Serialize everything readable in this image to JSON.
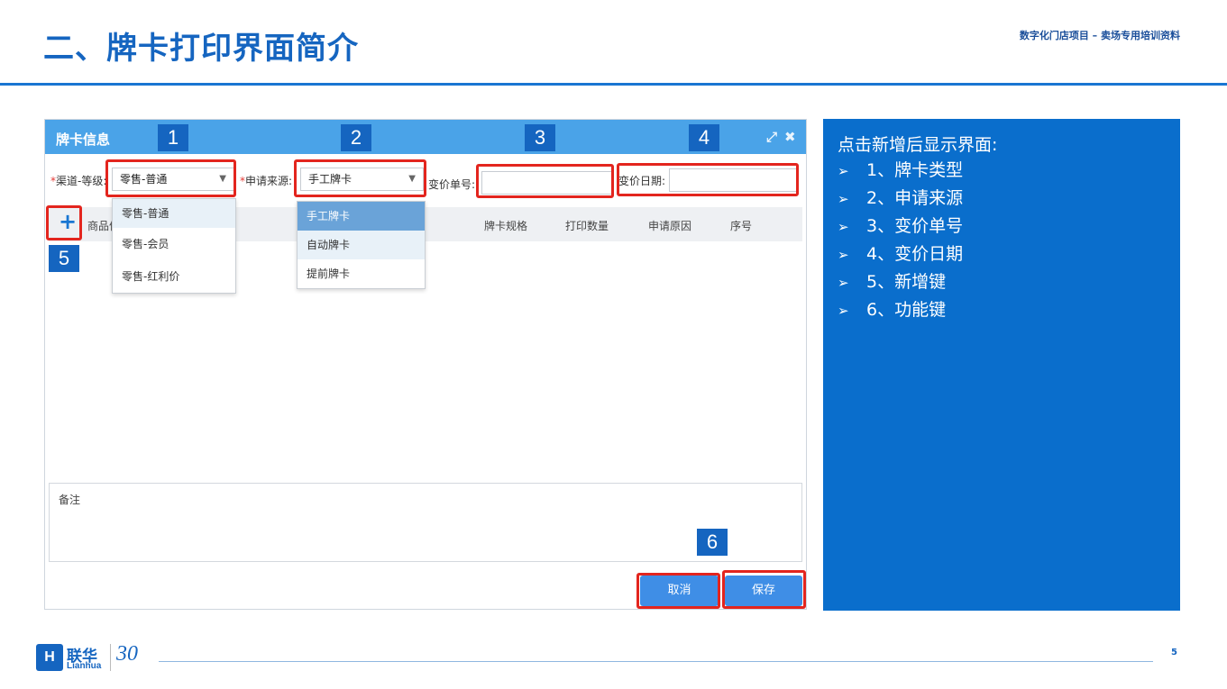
{
  "slide": {
    "title": "二、牌卡打印界面简介",
    "header_note": "数字化门店项目 – 卖场专用培训资料",
    "page_number": "5"
  },
  "dialog": {
    "title": "牌卡信息",
    "expand_icon": "expand-icon",
    "close_icon": "close-icon",
    "channel": {
      "label": "渠道-等级:",
      "required_mark": "*",
      "value": "零售-普通",
      "options": [
        "零售-普通",
        "零售-会员",
        "零售-红利价"
      ]
    },
    "source": {
      "label": "申请来源:",
      "required_mark": "*",
      "value": "手工牌卡",
      "options": [
        "手工牌卡",
        "自动牌卡",
        "提前牌卡"
      ]
    },
    "price_change_no": {
      "label": "变价单号:",
      "value": ""
    },
    "price_change_date": {
      "label": "变价日期:",
      "value": ""
    },
    "add_button": "+",
    "table_headers": [
      "商品信",
      "牌卡规格",
      "打印数量",
      "申请原因",
      "序号"
    ],
    "remarks_label": "备注",
    "cancel_label": "取消",
    "save_label": "保存"
  },
  "badges": [
    "1",
    "2",
    "3",
    "4",
    "5",
    "6"
  ],
  "info_panel": {
    "heading": "点击新增后显示界面:",
    "bullet": "➢",
    "items": [
      "1、牌卡类型",
      "2、申请来源",
      "3、变价单号",
      "4、变价日期",
      "5、新增键",
      "6、功能键"
    ]
  },
  "footer": {
    "logo_mark": "H",
    "logo_cn": "联华",
    "logo_en": "Lianhua",
    "logo_anniversary": "30"
  },
  "colors": {
    "brand_blue": "#1565c0",
    "dialog_bar": "#4aa3e8",
    "highlight_red": "#e3251e",
    "panel_blue": "#0a6ecc",
    "button_blue": "#3f8ee6"
  }
}
